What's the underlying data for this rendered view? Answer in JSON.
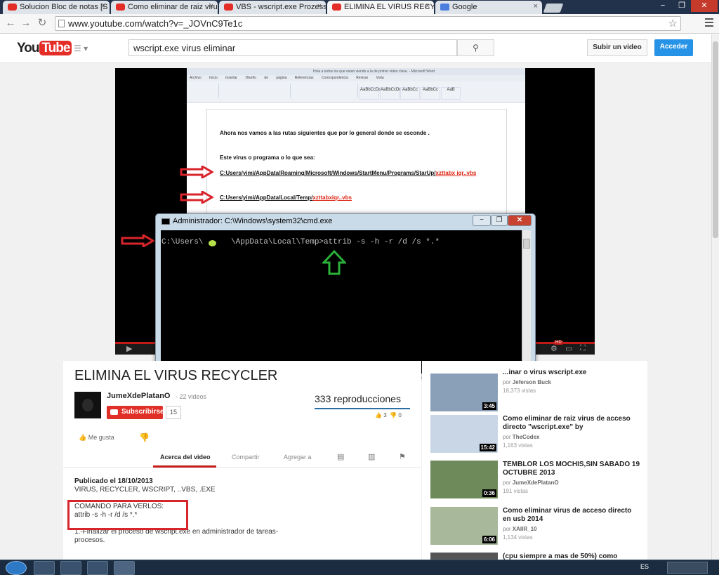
{
  "browser": {
    "tabs": [
      {
        "label": "Solucion Bloc de notas [S",
        "icon": "youtube-icon"
      },
      {
        "label": "Como eliminar de raiz viru",
        "icon": "youtube-icon"
      },
      {
        "label": "VBS - wscript.exe Prozess",
        "icon": "youtube-icon"
      },
      {
        "label": "ELIMINA EL VIRUS RECYCL",
        "icon": "youtube-icon"
      },
      {
        "label": "Google",
        "icon": "google-icon"
      }
    ],
    "tab_close": "×",
    "url": "www.youtube.com/watch?v=_JOVnC9Te1c",
    "window_controls": {
      "minimize": "−",
      "restore": "❐",
      "close": "✕"
    }
  },
  "youtube": {
    "logo_you": "You",
    "logo_tube": "Tube",
    "search_value": "wscript.exe virus eliminar",
    "upload_label": "Subir un video",
    "login_label": "Acceder"
  },
  "video_frame": {
    "word_title": "Hola a todos los que estan viendo a la de primer video clase. - Microsoft Word",
    "word_tabs": "Archivo Inicio Insertar Diseño de página Referencias Correspondencia Revisar Vista",
    "styles": [
      "AaBbCcDc",
      "AaBbCcDc",
      "AaBbCc",
      "AaBbCc",
      "AaB",
      "AaBbCc"
    ],
    "doc_line1": "Ahora nos vamos a las rutas siguientes que por lo general donde se esconde .",
    "doc_line2": "Este virus o programa o lo que sea:",
    "doc_path1": "C:Users/yimi/AppData/Roaming/Microsoft/Windows/StartMenu/Programs/StarUp/",
    "doc_path1_red": "xzttabx iqr..vbs",
    "doc_path2": "C:Users/yimi/AppData/Local/Temp/",
    "doc_path2_red": "xzttabxiqr..vbs",
    "hd_badge": "HD",
    "cmd_title": "Administrador: C:\\Windows\\system32\\cmd.exe",
    "cmd_line": "C:\\Users\\      \\AppData\\Local\\Temp>attrib -s -h -r /d /s *.*"
  },
  "video": {
    "title": "ELIMINA EL VIRUS RECYCLER",
    "channel": "JumeXdePlatanO",
    "channel_videos": "· 22 videos",
    "subscribe_label": "Subscribirse",
    "subscribers": "15",
    "views": "333 reproducciones",
    "likes": "3",
    "dislikes": "0",
    "like_label": "Me gusta",
    "tabs": [
      "Acerca del video",
      "Compartir",
      "Agregar a"
    ],
    "published": "Publicado el 18/10/2013",
    "tags": "VIRUS, RECYCLER, WSCRIPT, ..VBS, .EXE",
    "command_label": "COMANDO PARA VERLOS:",
    "command": "attrib -s -h -r /d /s *.*",
    "step1": "1.-Finalizar el proceso de wscript.exe en administrador de tareas- procesos."
  },
  "related": [
    {
      "title": "...inar o virus wscript.exe",
      "by": "Jeferson Buck",
      "views": "18,373 vistas",
      "duration": "3:45"
    },
    {
      "title": "Como eliminar de raiz virus de acceso directo \"wscript.exe\" by",
      "by": "TheCodex",
      "views": "1,163 vistas",
      "duration": "15:42"
    },
    {
      "title": "TEMBLOR LOS MOCHIS,SIN SABADO 19 OCTUBRE 2013",
      "by": "JumeXdePlatanO",
      "views": "191 vistas",
      "duration": "0:36"
    },
    {
      "title": "Como eliminar virus de acceso directo en usb 2014",
      "by": "XAIIR_10",
      "views": "1,134 vistas",
      "duration": "6:06"
    },
    {
      "title": "(cpu siempre a mas de 50%) como",
      "by": "",
      "views": "",
      "duration": ""
    }
  ],
  "related_by_prefix": "por ",
  "taskbar": {
    "language": "ES"
  }
}
